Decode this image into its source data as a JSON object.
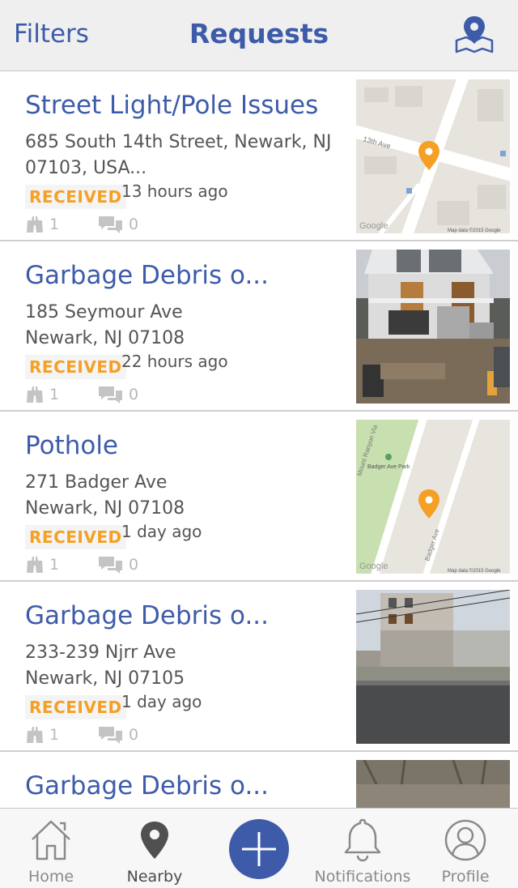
{
  "header": {
    "filters_label": "Filters",
    "title": "Requests",
    "map_icon": "map-pin-icon"
  },
  "colors": {
    "brand_blue": "#3d5ba9",
    "status_orange": "#f5a025",
    "header_bg": "#efefef"
  },
  "requests": [
    {
      "title": "Street Light/Pole Issues",
      "address_line1": "685 South 14th Street, Newark, NJ",
      "address_line2": "07103, USA...",
      "status": "RECEIVED",
      "time": "13 hours ago",
      "follows": "1",
      "comments": "0",
      "thumb": "map",
      "map_street_label": "13th Ave",
      "map_google": "Google",
      "map_credit": "Map data ©2015 Google"
    },
    {
      "title": "Garbage Debris o...",
      "address_line1": "185 Seymour Ave",
      "address_line2": "Newark, NJ 07108",
      "status": "RECEIVED",
      "time": "22 hours ago",
      "follows": "1",
      "comments": "0",
      "thumb": "photo-house"
    },
    {
      "title": "Pothole",
      "address_line1": "271 Badger Ave",
      "address_line2": "Newark, NJ 07108",
      "status": "RECEIVED",
      "time": "1 day ago",
      "follows": "1",
      "comments": "0",
      "thumb": "map",
      "map_park_label": "Badger Ave Park",
      "map_street_label": "Badger Ave",
      "map_street_label2": "Mount Ranyon Via",
      "map_google": "Google",
      "map_credit": "Map data ©2015 Google"
    },
    {
      "title": "Garbage Debris o...",
      "address_line1": "233-239 Njrr Ave",
      "address_line2": "Newark, NJ 07105",
      "status": "RECEIVED",
      "time": "1 day ago",
      "follows": "1",
      "comments": "0",
      "thumb": "photo-building"
    },
    {
      "title": "Garbage Debris o...",
      "thumb": "photo-trees"
    }
  ],
  "tabbar": {
    "home": "Home",
    "nearby": "Nearby",
    "notifications": "Notifications",
    "profile": "Profile"
  }
}
